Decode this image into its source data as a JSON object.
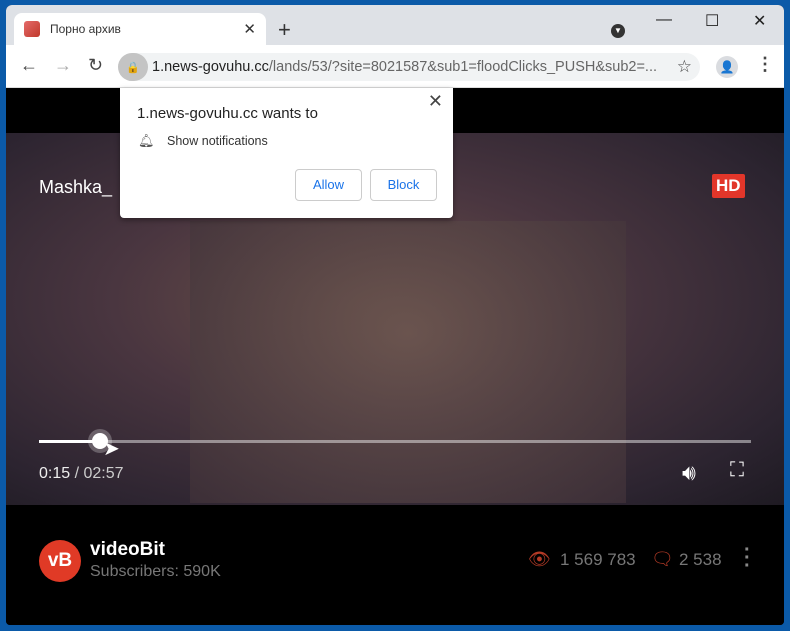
{
  "browser": {
    "tab_title": "Порно архив",
    "url_host": "1.news-govuhu.cc",
    "url_path": "/lands/53/?site=8021587&sub1=floodClicks_PUSH&sub2=..."
  },
  "popup": {
    "title": "1.news-govuhu.cc wants to",
    "permission": "Show notifications",
    "allow": "Allow",
    "block": "Block"
  },
  "video": {
    "title": "Mashka_",
    "badge": "HD",
    "current_time": "0:15",
    "duration": "/ 02:57",
    "progress_percent": 8.5
  },
  "channel": {
    "avatar_text": "vB",
    "name": "videoBit",
    "subscribers": "Subscribers: 590K",
    "views": "1 569 783",
    "comments": "2 538"
  },
  "colors": {
    "accent": "#e2362a",
    "allow_text": "#1a73e8"
  }
}
